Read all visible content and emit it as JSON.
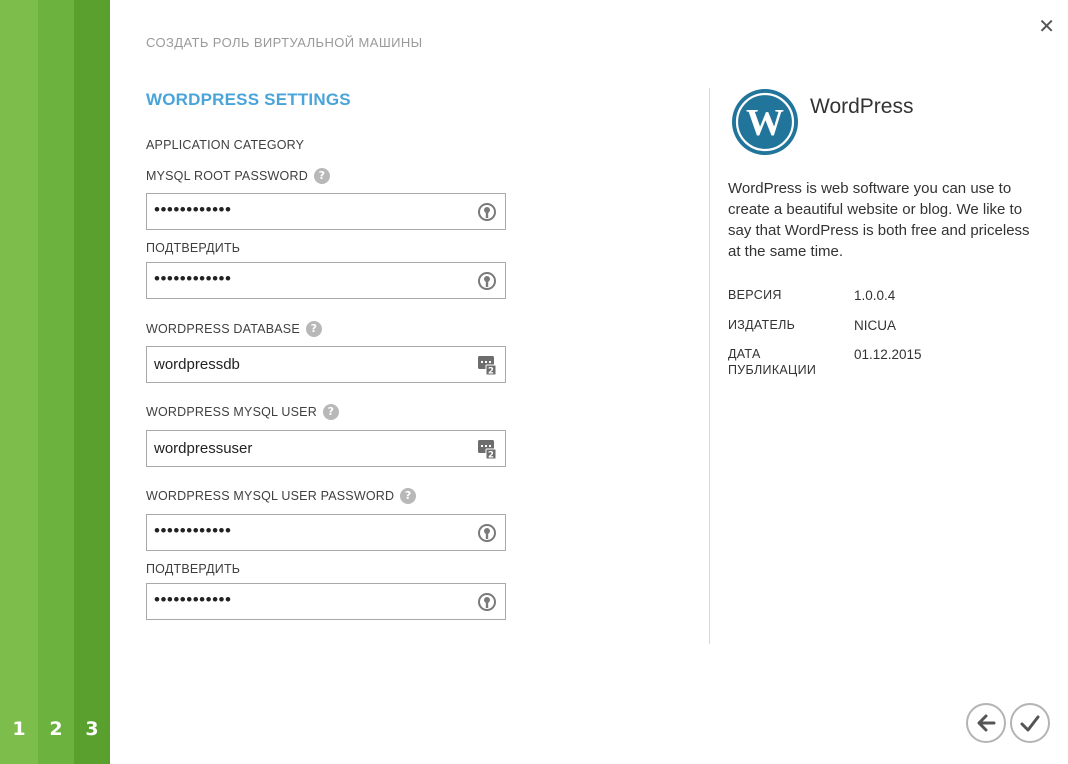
{
  "wizard": {
    "title": "СОЗДАТЬ РОЛЬ ВИРТУАЛЬНОЙ МАШИНЫ",
    "steps": [
      "1",
      "2",
      "3"
    ],
    "close_icon": "close-icon"
  },
  "form": {
    "section_title": "WORDPRESS SETTINGS",
    "category_label": "APPLICATION CATEGORY",
    "mysql_root_password": {
      "label": "MYSQL ROOT PASSWORD",
      "value": "••••••••••••"
    },
    "mysql_root_confirm": {
      "label": "ПОДТВЕРДИТЬ",
      "value": "••••••••••••"
    },
    "wp_database": {
      "label": "WORDPRESS DATABASE",
      "value": "wordpressdb"
    },
    "wp_mysql_user": {
      "label": "WORDPRESS MYSQL USER",
      "value": "wordpressuser"
    },
    "wp_mysql_user_password": {
      "label": "WORDPRESS MYSQL USER PASSWORD",
      "value": "••••••••••••"
    },
    "wp_mysql_user_confirm": {
      "label": "ПОДТВЕРДИТЬ",
      "value": "••••••••••••"
    },
    "help_glyph": "?"
  },
  "app_info": {
    "name": "WordPress",
    "description": "WordPress is web software you can use to create a beautiful website or blog. We like to say that WordPress is both free and priceless at the same time.",
    "version_label": "ВЕРСИЯ",
    "version": "1.0.0.4",
    "publisher_label": "ИЗДАТЕЛЬ",
    "publisher": "NICUA",
    "date_label_line1": "ДАТА",
    "date_label_line2": "ПУБЛИКАЦИИ",
    "date": "01.12.2015"
  },
  "icons": {
    "password": "key-icon",
    "generated": "generate-value-icon",
    "back": "back-arrow-icon",
    "finish": "checkmark-icon"
  },
  "colors": {
    "step1": "#7dbd4c",
    "step2": "#6cb23e",
    "step3": "#5aa02e",
    "accent": "#49a4d9",
    "wp_logo": "#21759b"
  }
}
